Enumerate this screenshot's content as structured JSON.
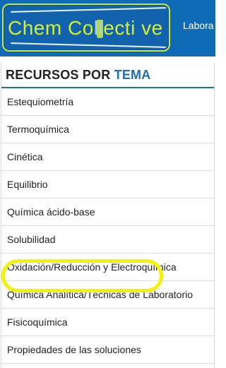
{
  "header": {
    "logo": {
      "text_part1": "Chem Co",
      "text_part2": "ll",
      "text_part3": "ecti ve",
      "alt": "ChemCollective"
    },
    "nav_label": "Labora",
    "colors": {
      "bar": "#0f6bb6",
      "logo_green": "#d6ee2e",
      "logo_light_blue": "#9fd0f5"
    }
  },
  "panel": {
    "title_main": "RECURSOS POR ",
    "title_accent": "TEMA",
    "accent_color": "#1f6db3",
    "topics": [
      "Estequiometría",
      "Termoquímica",
      "Cinética",
      "Equilibrio",
      "Química ácido-base",
      "Solubilidad",
      "Oxidación/Reducción y Electroquímica",
      "Química Analítica/Técnicas de Laboratorio",
      "Fisicoquímica",
      "Propiedades de las soluciones"
    ],
    "highlighted_topic": "Química ácido-base",
    "highlight_color": "#f5f20a"
  }
}
